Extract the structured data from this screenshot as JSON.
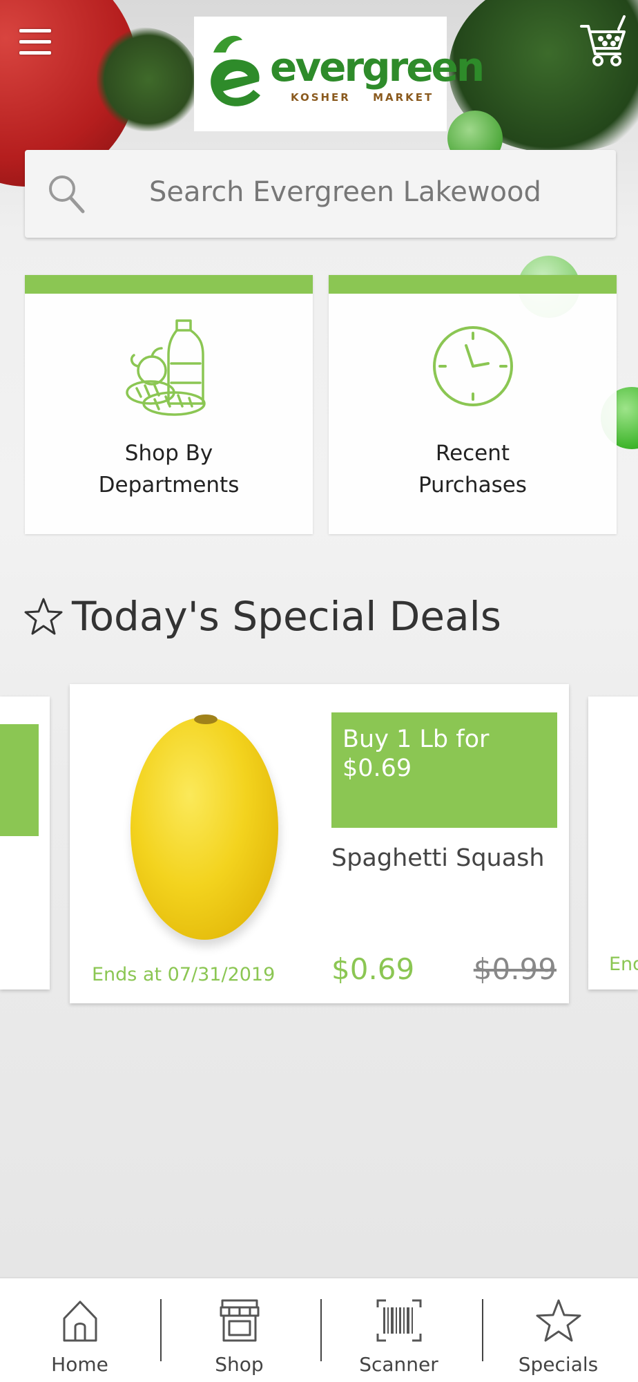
{
  "header": {
    "brand_name": "evergreen",
    "brand_sub": "KOSHER MARKET",
    "menu_icon": "hamburger-menu-icon",
    "cart_icon": "shopping-cart-icon"
  },
  "search": {
    "placeholder": "Search Evergreen Lakewood"
  },
  "tiles": [
    {
      "label_line1": "Shop By",
      "label_line2": "Departments",
      "icon": "groceries-icon"
    },
    {
      "label_line1": "Recent",
      "label_line2": "Purchases",
      "icon": "clock-icon"
    }
  ],
  "deals": {
    "title": "Today's Special Deals",
    "cards": [
      {
        "deal_line1": "Buy 1 Lb for",
        "deal_line2": "$0.69",
        "product_name": "Spaghetti Squash",
        "sale_price": "$0.69",
        "original_price": "$0.99",
        "ends": "Ends at 07/31/2019"
      }
    ],
    "next_card_ends": "Ends"
  },
  "bottom_nav": [
    {
      "label": "Home",
      "icon": "home-icon"
    },
    {
      "label": "Shop",
      "icon": "store-icon"
    },
    {
      "label": "Scanner",
      "icon": "barcode-icon"
    },
    {
      "label": "Specials",
      "icon": "star-icon"
    }
  ],
  "colors": {
    "accent_green": "#8bc653",
    "brand_green": "#2e8b2a",
    "brand_brown": "#8a5a1e"
  }
}
